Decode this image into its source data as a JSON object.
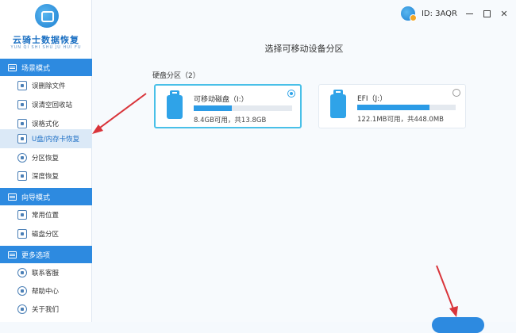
{
  "app": {
    "logo_title": "云骑士数据恢复",
    "logo_subtitle": "YUN QI SHI SHU JU HUI FU",
    "user_id": "ID: 3AQR"
  },
  "sidebar": {
    "sections": [
      {
        "label": "场景模式",
        "items": [
          {
            "label": "误删除文件",
            "icon": "trash-icon"
          },
          {
            "label": "误清空回收站",
            "icon": "recycle-bin-icon"
          },
          {
            "label": "误格式化",
            "icon": "format-icon"
          },
          {
            "label": "U盘/内存卡恢复",
            "icon": "usb-card-icon",
            "active": true
          },
          {
            "label": "分区恢复",
            "icon": "partition-icon"
          },
          {
            "label": "深度恢复",
            "icon": "deep-scan-icon"
          }
        ]
      },
      {
        "label": "向导模式",
        "items": [
          {
            "label": "常用位置",
            "icon": "location-icon"
          },
          {
            "label": "磁盘分区",
            "icon": "disk-partition-icon"
          }
        ]
      },
      {
        "label": "更多选项",
        "items": [
          {
            "label": "联系客服",
            "icon": "headset-icon"
          },
          {
            "label": "帮助中心",
            "icon": "help-icon"
          },
          {
            "label": "关于我们",
            "icon": "info-icon"
          }
        ]
      }
    ]
  },
  "main": {
    "title": "选择可移动设备分区",
    "group_label": "硬盘分区（2）",
    "drives": [
      {
        "name": "可移动磁盘（I:）",
        "size": "8.4GB可用，共13.8GB",
        "used_fraction": 0.39,
        "selected": true
      },
      {
        "name": "EFI（J:）",
        "size": "122.1MB可用，共448.0MB",
        "used_fraction": 0.73,
        "selected": false
      }
    ]
  },
  "colors": {
    "accent": "#2d8ae0",
    "selected_border": "#49c0e8",
    "arrow": "#d9343a"
  }
}
